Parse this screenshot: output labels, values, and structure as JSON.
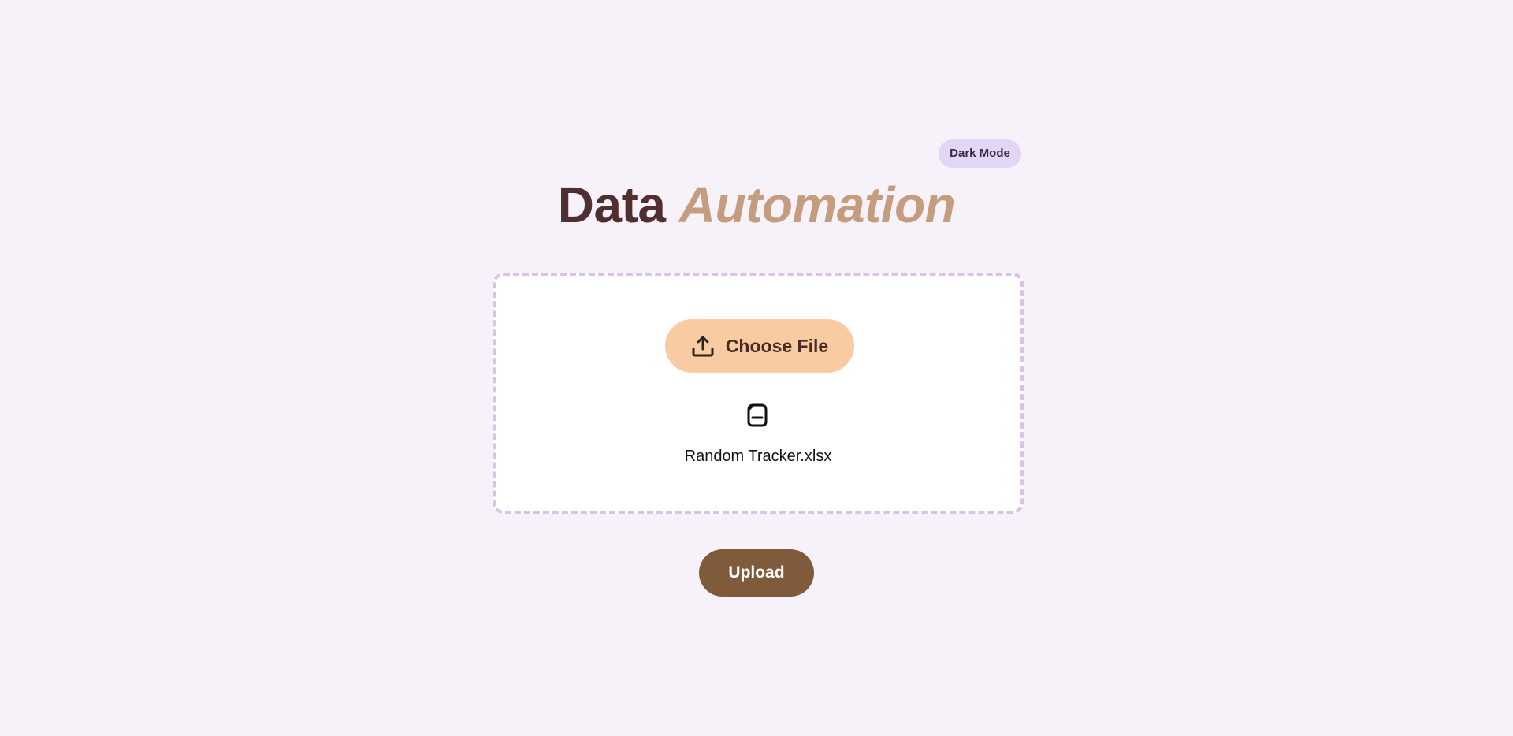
{
  "header": {
    "dark_mode_label": "Dark Mode",
    "title_plain": "Data",
    "title_accent": "Automation"
  },
  "dropzone": {
    "choose_label": "Choose File",
    "choose_icon": "upload-icon",
    "file_icon": "file-icon",
    "file_name": "Random Tracker.xlsx"
  },
  "actions": {
    "upload_label": "Upload"
  },
  "colors": {
    "background": "#f7f1fa",
    "toggle_bg": "#e3d6f5",
    "title_plain": "#4f2f2f",
    "title_accent": "#c49d7e",
    "dropzone_border": "#d9c3e8",
    "choose_bg": "#f9cba2",
    "upload_bg": "#7f5b3b"
  }
}
